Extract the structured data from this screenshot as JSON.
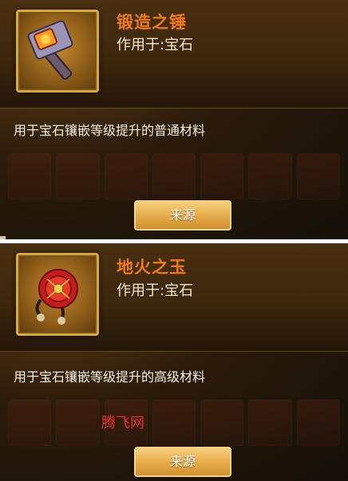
{
  "cards": [
    {
      "name": "锻造之锤",
      "usage": "作用于:宝石",
      "description": "用于宝石镶嵌等级提升的普通材料",
      "source_label": "来源",
      "icon": "forge-hammer-icon"
    },
    {
      "name": "地火之玉",
      "usage": "作用于:宝石",
      "description": "用于宝石镶嵌等级提升的高级材料",
      "source_label": "来源",
      "icon": "earth-fire-jade-icon"
    }
  ],
  "watermark": "腾飞网",
  "colors": {
    "name_orange": "#f07a1a",
    "frame_gold": "#d7a742",
    "button_gold": "#e7ad4c"
  }
}
